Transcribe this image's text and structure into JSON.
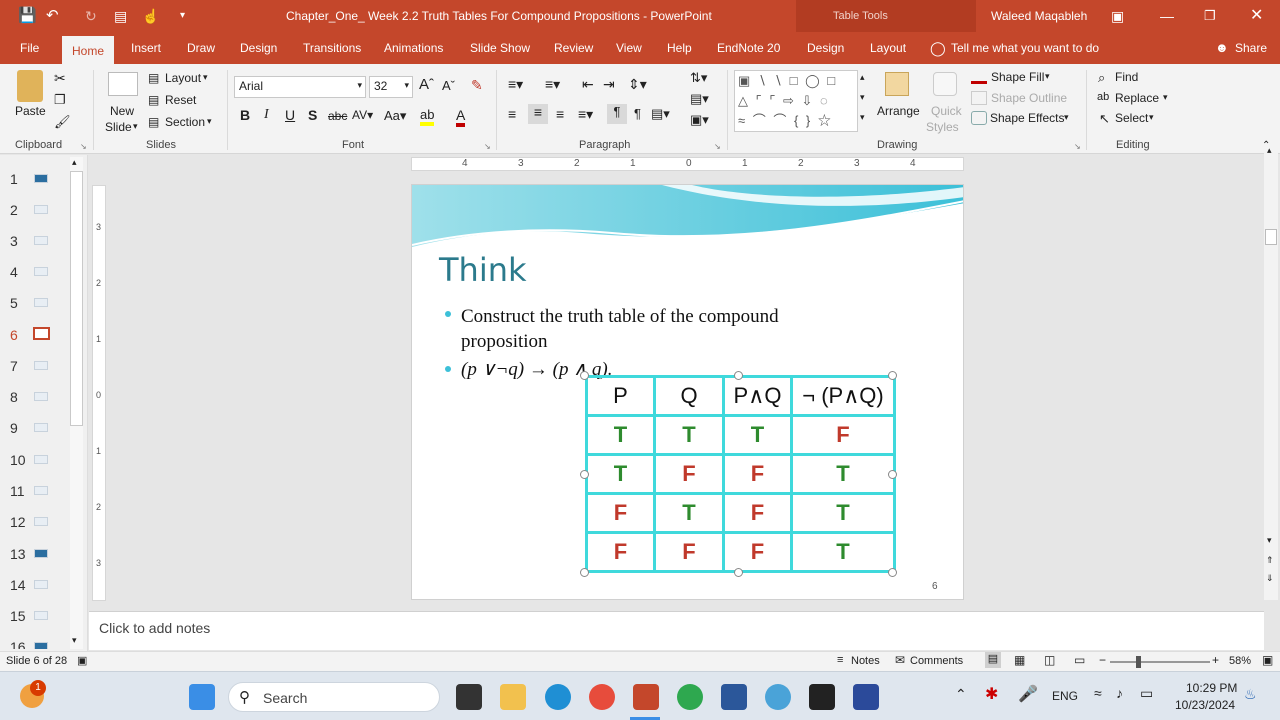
{
  "window": {
    "title": "Chapter_One_ Week 2.2 Truth Tables For Compound Propositions  -  PowerPoint",
    "context_tab": "Table Tools",
    "user": "Waleed Maqableh"
  },
  "tabs": [
    "File",
    "Home",
    "Insert",
    "Draw",
    "Design",
    "Transitions",
    "Animations",
    "Slide Show",
    "Review",
    "View",
    "Help",
    "EndNote 20",
    "Design",
    "Layout"
  ],
  "tell_me": "Tell me what you want to do",
  "share": "Share",
  "ribbon": {
    "clipboard": {
      "paste": "Paste",
      "label": "Clipboard"
    },
    "slides": {
      "new_slide_1": "New",
      "new_slide_2": "Slide",
      "layout": "Layout",
      "reset": "Reset",
      "section": "Section",
      "label": "Slides"
    },
    "font": {
      "name": "Arial",
      "size": "32",
      "label": "Font"
    },
    "paragraph": {
      "label": "Paragraph"
    },
    "drawing": {
      "arrange": "Arrange",
      "quick_styles_1": "Quick",
      "quick_styles_2": "Styles",
      "shape_fill": "Shape Fill",
      "shape_outline": "Shape Outline",
      "shape_effects": "Shape Effects",
      "label": "Drawing"
    },
    "editing": {
      "find": "Find",
      "replace": "Replace",
      "select": "Select",
      "label": "Editing"
    }
  },
  "ruler_h": [
    "4",
    "3",
    "2",
    "1",
    "0",
    "1",
    "2",
    "3",
    "4"
  ],
  "ruler_v": [
    "3",
    "2",
    "1",
    "0",
    "1",
    "2",
    "3"
  ],
  "thumbnails": [
    "1",
    "2",
    "3",
    "4",
    "5",
    "6",
    "7",
    "8",
    "9",
    "10",
    "11",
    "12",
    "13",
    "14",
    "15",
    "16"
  ],
  "selected_slide": "6",
  "slide": {
    "title": "Think",
    "bullet1_line1": "Construct the truth table of the compound",
    "bullet1_line2": "proposition",
    "bullet2": "(p ∨¬q) → (p ∧ q).",
    "page_number": "6",
    "table": {
      "headers": [
        "P",
        "Q",
        "P∧Q",
        "¬ (P∧Q)"
      ],
      "rows": [
        [
          "T",
          "T",
          "T",
          "F"
        ],
        [
          "T",
          "F",
          "F",
          "T"
        ],
        [
          "F",
          "T",
          "F",
          "T"
        ],
        [
          "F",
          "F",
          "F",
          "T"
        ]
      ]
    }
  },
  "notes_placeholder": "Click to add notes",
  "status": {
    "slide_info": "Slide 6 of 28",
    "notes": "Notes",
    "comments": "Comments",
    "zoom": "58%"
  },
  "taskbar": {
    "search": "Search",
    "lang": "ENG",
    "time": "10:29 PM",
    "date": "10/23/2024",
    "badge": "1"
  },
  "colors": {
    "accent": "#c4472b",
    "table_border": "#3fd9dc",
    "true_green": "#2e8b2e",
    "false_red": "#c0392b",
    "title_teal": "#2b7a8c"
  }
}
